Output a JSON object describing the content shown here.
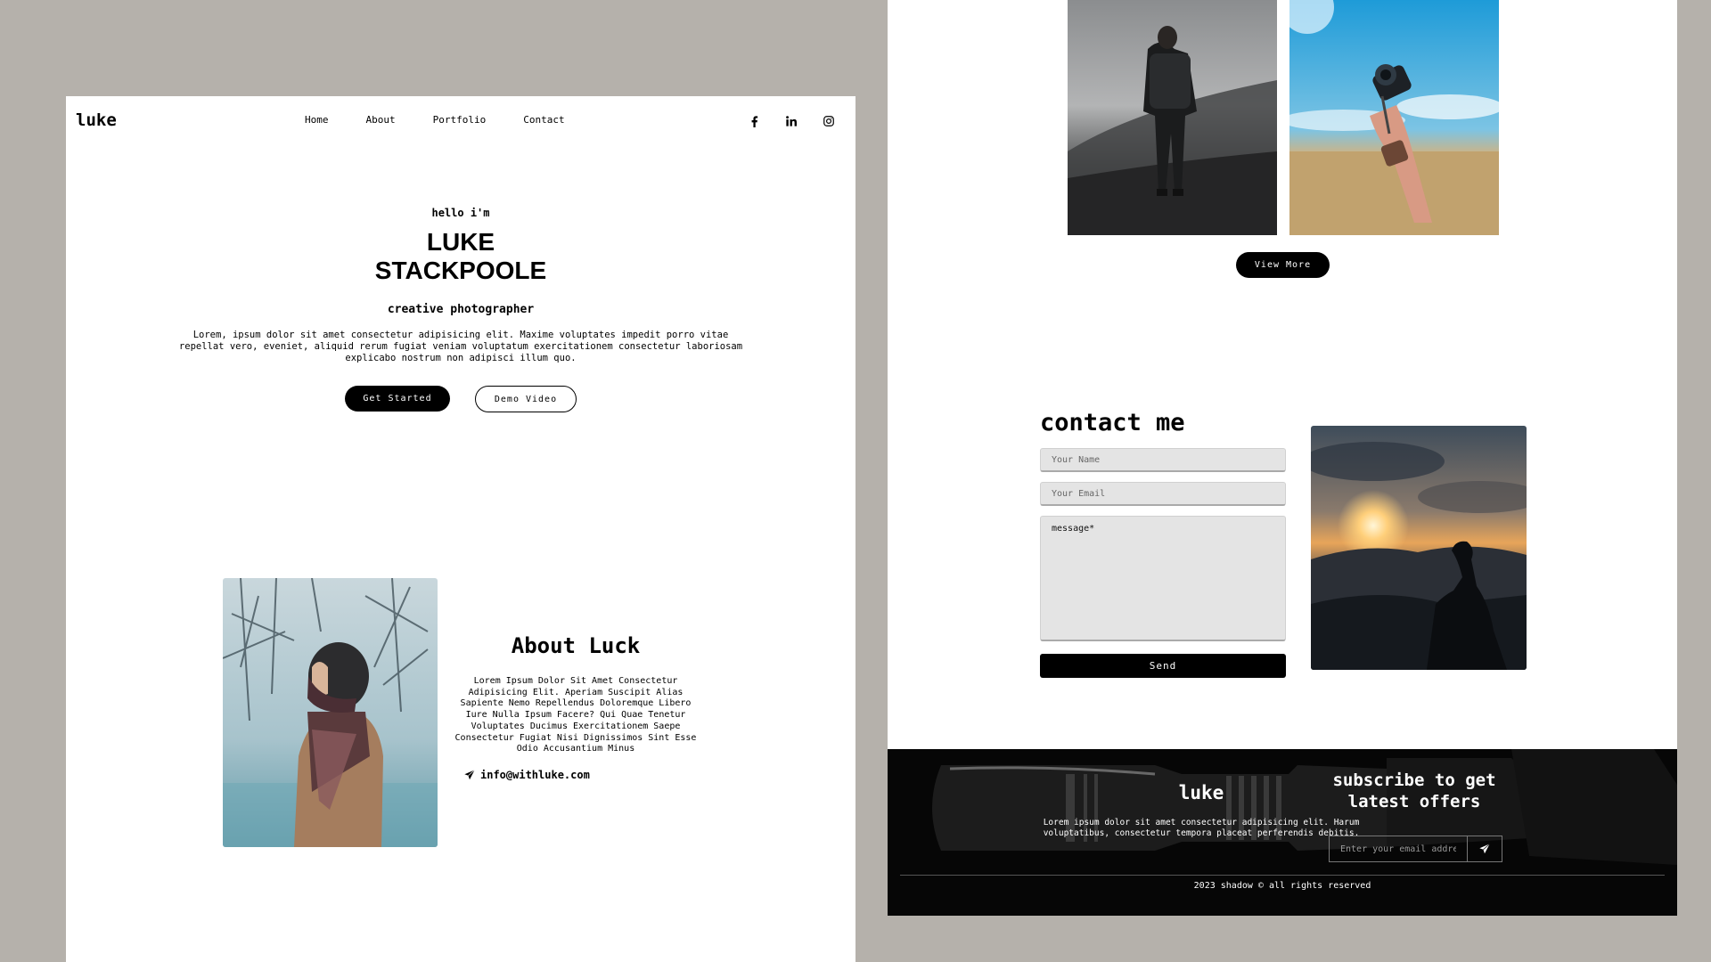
{
  "left_page": {
    "logo": "luke",
    "nav": [
      "Home",
      "About",
      "Portfolio",
      "Contact"
    ],
    "social_icons": [
      "facebook-icon",
      "linkedin-icon",
      "instagram-icon"
    ],
    "hero": {
      "greeting": "hello i'm",
      "name_line1": "LUKE",
      "name_line2": "STACKPOOLE",
      "role": "creative photographer",
      "description": "Lorem, ipsum dolor sit amet consectetur adipisicing elit. Maxime voluptates impedit porro vitae repellat vero, eveniet, aliquid rerum fugiat veniam voluptatum exercitationem consectetur laboriosam explicabo nostrum non adipisci illum quo.",
      "primary_button": "Get Started",
      "secondary_button": "Demo Video"
    },
    "about": {
      "title": "About Luck",
      "text": "Lorem Ipsum Dolor Sit Amet Consectetur Adipisicing Elit. Aperiam Suscipit Alias Sapiente Nemo Repellendus Doloremque Libero Iure Nulla Ipsum Facere? Qui Quae Tenetur Voluptates Ducimus Exercitationem Saepe Consectetur Fugiat Nisi Dignissimos Sint Esse Odio Accusantium Minus",
      "email": "info@withluke.com"
    }
  },
  "right_page": {
    "portfolio": {
      "view_more_button": "View More"
    },
    "contact": {
      "title": "contact me",
      "name_placeholder": "Your Name",
      "email_placeholder": "Your Email",
      "message_placeholder": "message*",
      "send_button": "Send"
    },
    "footer": {
      "logo": "luke",
      "description": "Lorem ipsum dolor sit amet consectetur adipisicing elit. Harum voluptatibus, consectetur tempora placeat perferendis debitis.",
      "subscribe_title": "subscribe to get latest offers",
      "subscribe_placeholder": "Enter your email address",
      "copyright": "2023 shadow © all rights reserved"
    }
  },
  "colors": {
    "background": "#b5b1ab",
    "panel": "#ffffff",
    "accent": "#000000",
    "footer": "#060606"
  }
}
